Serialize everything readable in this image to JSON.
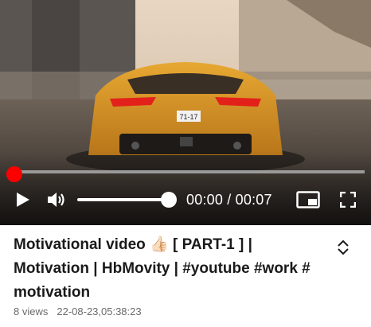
{
  "player": {
    "time": {
      "current": "00:00",
      "separator": " / ",
      "duration": "00:07"
    },
    "progress_fraction": 0.0,
    "volume_fraction": 1.0,
    "colors": {
      "progress_played": "#ff0000",
      "progress_track": "#9a9a9a",
      "controls": "#ffffff"
    },
    "icons": [
      "play-icon",
      "volume-icon",
      "picture-in-picture-icon",
      "fullscreen-icon"
    ]
  },
  "video": {
    "title_part1": "Motivational video ",
    "title_emoji": "👍🏻",
    "title_part2": " [ PART-1 ] | Motivation | HbMovity | #youtube #work # motivation",
    "views": "8 views",
    "date": "22-08-23,05:38:23",
    "expand_icon": "chevron-up-down-icon"
  },
  "thumbnail": {
    "plate": "71-17"
  }
}
